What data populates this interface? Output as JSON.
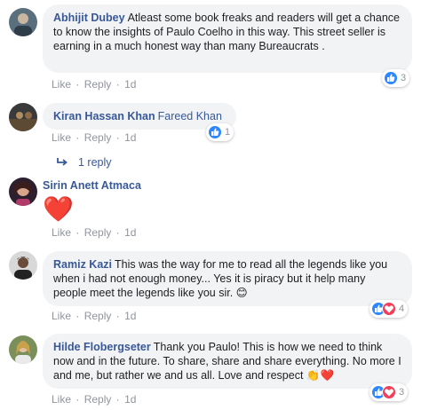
{
  "comments": [
    {
      "author": "Abhijit Dubey",
      "text": "Atleast some book freaks and readers will get a chance to know the insights of Paulo Coelho in this way. This street seller is earning in a much honest way than many Bureaucrats .",
      "like": "Like",
      "reply": "Reply",
      "time": "1d",
      "reaction_count": "3"
    },
    {
      "author": "Kiran Hassan Khan",
      "mention": "Fareed Khan",
      "like": "Like",
      "reply": "Reply",
      "time": "1d",
      "reaction_count": "1",
      "replies_label": "1 reply"
    },
    {
      "author": "Sirin Anett Atmaca",
      "emoji": "❤️",
      "like": "Like",
      "reply": "Reply",
      "time": "1d"
    },
    {
      "author": "Ramiz Kazi",
      "text": "This was the way for me to read all the legends like you when i had not enough money... Yes it is piracy but it help many people meet the legends like you sir. 😊",
      "like": "Like",
      "reply": "Reply",
      "time": "1d",
      "reaction_count": "4"
    },
    {
      "author": "Hilde Flobergseter",
      "text": "Thank you Paulo! This is how we need to think now and in the future. To share, share and share everything. No more I and me, but rather we and us all. Love and respect 👏❤️",
      "like": "Like",
      "reply": "Reply",
      "time": "1d",
      "reaction_count": "3"
    }
  ],
  "separator": "·",
  "colors": {
    "name": "#385898",
    "bubble": "#f2f3f5",
    "meta": "#90949c",
    "like": "#2d88ff",
    "love": "#f33e58"
  }
}
